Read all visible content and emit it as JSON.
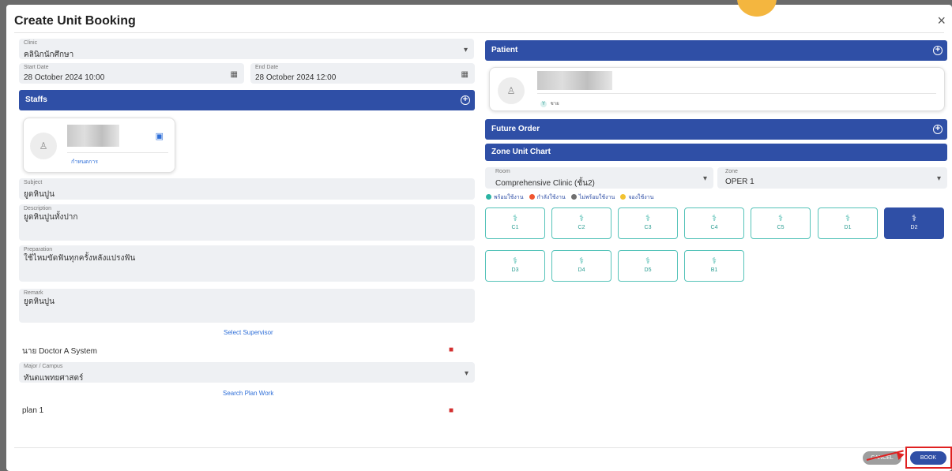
{
  "dialog": {
    "title": "Create Unit Booking",
    "close_icon": "×"
  },
  "clinic": {
    "label": "Clinic",
    "value": "คลินิกนักศึกษา"
  },
  "start_date": {
    "label": "Start Date",
    "value": "28 October 2024 10:00"
  },
  "end_date": {
    "label": "End Date",
    "value": "28 October 2024 12:00"
  },
  "staffs": {
    "title": "Staffs",
    "card_link": "กำหนดการ"
  },
  "subject": {
    "label": "Subject",
    "value": "ยูดหินปูน"
  },
  "description": {
    "label": "Description",
    "value": "ยูดหินปูนทั้งปาก"
  },
  "preparation": {
    "label": "Preparation",
    "value": "ใช้ไหมขัดฟันทุกครั้งหลังแปรงฟัน"
  },
  "remark": {
    "label": "Remark",
    "value": "ยูดหินปูน"
  },
  "supervisor": {
    "select_label": "Select Supervisor",
    "name": "นาย Doctor A System"
  },
  "major": {
    "label": "Major / Campus",
    "value": "ทันตแพทยศาสตร์"
  },
  "plan": {
    "search_label": "Search Plan Work",
    "name": "plan 1"
  },
  "patient": {
    "title": "Patient",
    "gender": "ชาย"
  },
  "future_order": {
    "title": "Future Order"
  },
  "zone_chart": {
    "title": "Zone Unit Chart",
    "room_label": "Room",
    "room_value": "Comprehensive Clinic (ชั้น2)",
    "zone_label": "Zone",
    "zone_value": "OPER 1",
    "legend": [
      {
        "label": "พร้อมใช้งาน",
        "color": "#2bb3a3"
      },
      {
        "label": "กำลังใช้งาน",
        "color": "#f0552f"
      },
      {
        "label": "ไม่พร้อมใช้งาน",
        "color": "#707070"
      },
      {
        "label": "จองใช้งาน",
        "color": "#f2c230"
      }
    ],
    "units": [
      "C1",
      "C2",
      "C3",
      "C4",
      "C5",
      "D1",
      "D2",
      "D3",
      "D4",
      "D5",
      "B1"
    ],
    "selected_unit": "D2"
  },
  "footer": {
    "cancel_label": "CANCEL",
    "book_label": "BOOK"
  },
  "colors": {
    "primary": "#2f4fa6",
    "teal": "#3bb5a8",
    "danger": "#d32f2f"
  }
}
